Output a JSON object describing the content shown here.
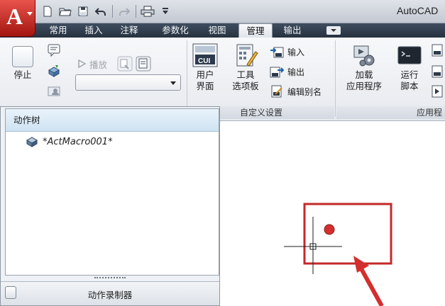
{
  "app": {
    "title": "AutoCAD"
  },
  "ribbon_tabs": [
    "常用",
    "插入",
    "注释",
    "参数化",
    "视图",
    "管理",
    "输出"
  ],
  "active_tab": "管理",
  "action_recorder_panel": {
    "stop_label": "停止",
    "play_label": "播放",
    "palette_title": "动作录制器"
  },
  "custom_panel": {
    "label": "自定义设置",
    "user_interface": [
      "用户",
      "界面"
    ],
    "tool_palettes": [
      "工具",
      "选项板"
    ],
    "import_label": "输入",
    "export_label": "输出",
    "edit_aliases_label": "编辑别名"
  },
  "apps_panel": {
    "label": "应用程",
    "load_app": [
      "加载",
      "应用程序"
    ],
    "run_script": [
      "运行",
      "脚本"
    ]
  },
  "action_tree": {
    "header": "动作树",
    "items": [
      "*ActMacro001*"
    ]
  },
  "icon_text": {
    "cui": "CUI",
    "app_letter": "A"
  },
  "colors": {
    "app_button": "#c8241c",
    "ribbon_tabs_bg": "#2f3b4a",
    "tree_header": "#d8e9f6",
    "highlight_box": "#c62828",
    "red_dot": "#d32f2f"
  },
  "icons": [
    "autocad-app-icon",
    "new-icon",
    "open-icon",
    "save-icon",
    "undo-icon",
    "redo-icon",
    "plot-icon",
    "macro-icon",
    "cursor-crosshair-icon",
    "arrow-pointer"
  ]
}
